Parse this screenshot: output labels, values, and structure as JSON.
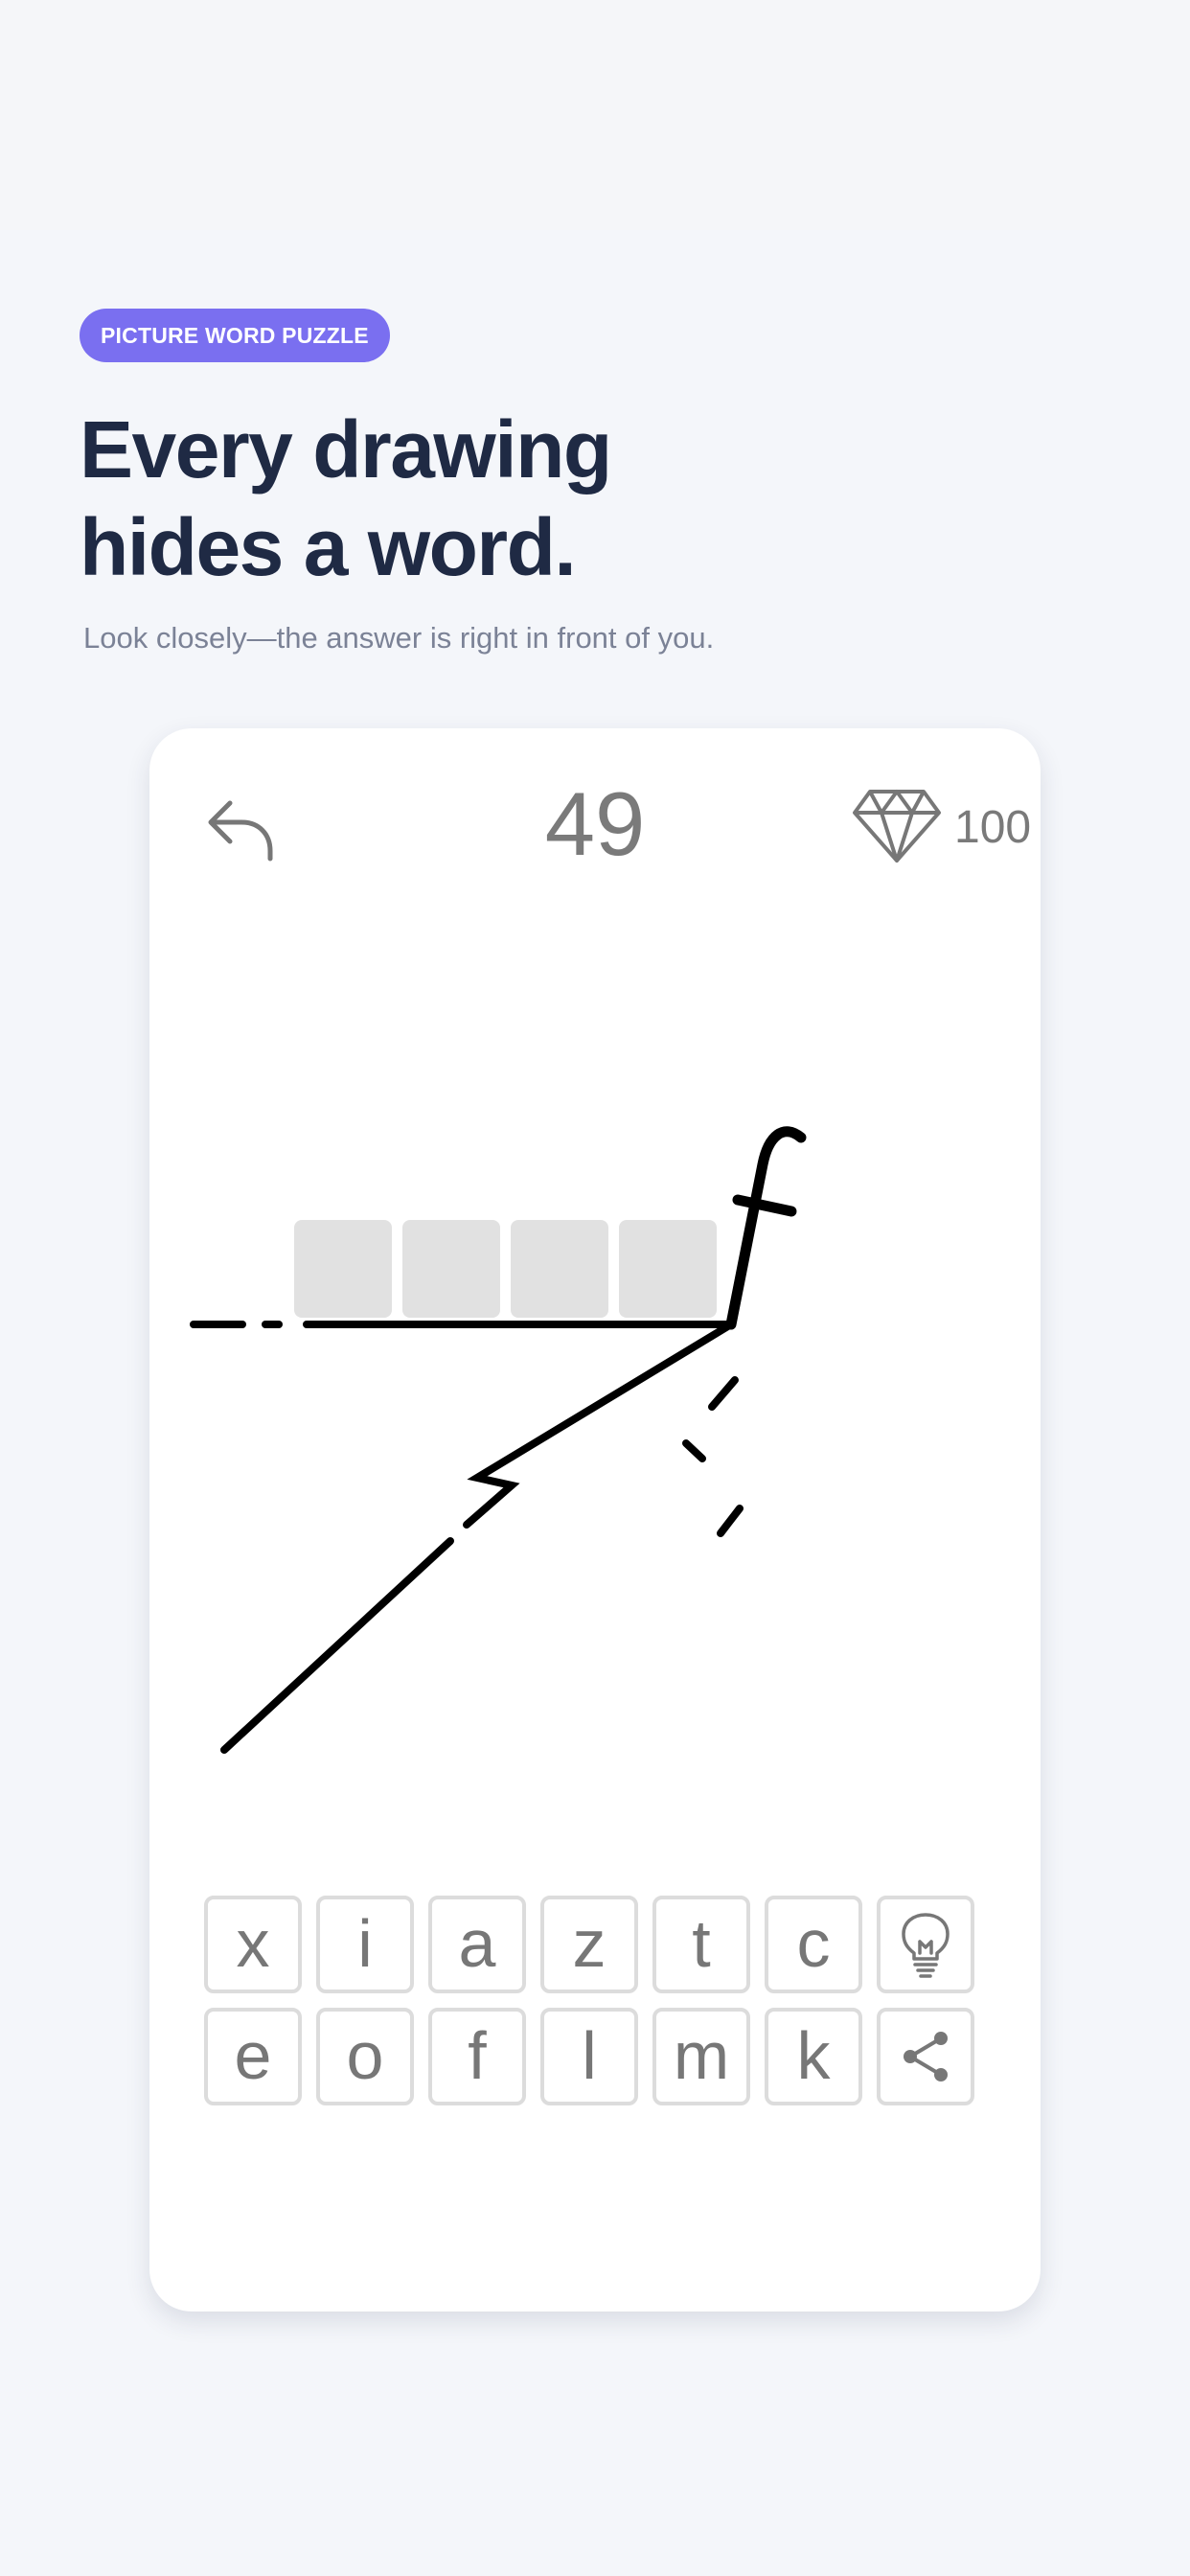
{
  "badge": "PICTURE WORD PUZZLE",
  "headline": {
    "line1": "Every drawing",
    "line2": "hides a word."
  },
  "subtitle": "Look closely—the answer is right in front of you.",
  "game": {
    "level": "49",
    "coins": "100",
    "answer_slots": [
      "",
      "",
      "",
      ""
    ],
    "drawing_letter": "f",
    "keyboard_row1": [
      "x",
      "i",
      "a",
      "z",
      "t",
      "c"
    ],
    "keyboard_row2": [
      "e",
      "o",
      "f",
      "l",
      "m",
      "k"
    ],
    "icons": {
      "back": "undo-arrow-icon",
      "currency": "diamond-icon",
      "hint": "lightbulb-icon",
      "share": "share-icon"
    }
  },
  "colors": {
    "background": "#f4f6fa",
    "badge": "#7a6ff0",
    "headline": "#1f2a44",
    "subtitle": "#7b8296",
    "card": "#ffffff",
    "slot": "#e1e1e1",
    "key_border": "#dcdcdc",
    "key_text": "#777777",
    "drawing": "#000000"
  }
}
